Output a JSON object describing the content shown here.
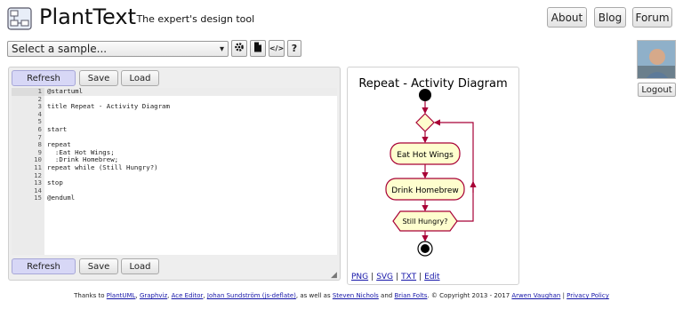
{
  "header": {
    "brand": "PlantText",
    "tagline": "- The expert's design tool",
    "nav": {
      "about": "About",
      "blog": "Blog",
      "forum": "Forum"
    }
  },
  "sample_select": {
    "value": "Select a sample...",
    "arrow": "▾"
  },
  "tools": {
    "gear": "⚙",
    "file": "📄",
    "code": "</>",
    "help": "?"
  },
  "user": {
    "logout_label": "Logout"
  },
  "editor": {
    "refresh_label": "Refresh",
    "save_label": "Save",
    "load_label": "Load",
    "line_numbers": [
      "1",
      "2",
      "3",
      "4",
      "5",
      "6",
      "7",
      "8",
      "9",
      "10",
      "11",
      "12",
      "13",
      "14",
      "15"
    ],
    "lines": [
      "@startuml",
      "",
      "title Repeat - Activity Diagram",
      "",
      "",
      "start",
      "",
      "repeat",
      "  :Eat Hot Wings;",
      "  :Drink Homebrew;",
      "repeat while (Still Hungry?)",
      "",
      "stop",
      "",
      "@enduml"
    ]
  },
  "diagram": {
    "title": "Repeat - Activity Diagram",
    "activities": [
      "Eat Hot Wings",
      "Drink Homebrew"
    ],
    "condition": "Still Hungry?",
    "colors": {
      "activity_fill": "#fefece",
      "border": "#a80036",
      "start_end": "#000000"
    }
  },
  "export": {
    "png": "PNG",
    "svg": "SVG",
    "txt": "TXT",
    "edit": "Edit",
    "sep": "|"
  },
  "footer": {
    "thanks": "Thanks to",
    "plantuml": "PlantUML",
    "graphviz": "Graphviz",
    "ace": "Ace Editor",
    "deflate": "Johan Sundström (js-deflate)",
    "as_well_as": "as well as",
    "steven": "Steven Nichols",
    "and": "and",
    "brian": "Brian Folts",
    "copyright": ". © Copyright 2013 - 2017",
    "arwen": "Arwen Vaughan",
    "privacy": "Privacy Policy",
    "comma": ",",
    "pipe": "|"
  }
}
